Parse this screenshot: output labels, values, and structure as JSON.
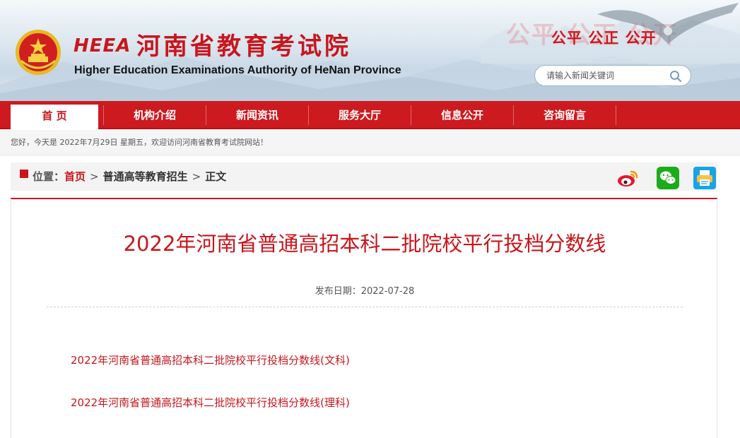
{
  "header": {
    "logo_abbr": "HEEA",
    "logo_name_cn": "河南省教育考试院",
    "logo_name_en": "Higher Education Examinations Authority of HeNan Province",
    "slogan": "公平 公正 公开",
    "slogan_ghost": "公平 公正 公开",
    "search": {
      "placeholder": "请输入新闻关键词",
      "value": ""
    }
  },
  "nav": {
    "items": [
      {
        "label": "首 页",
        "active": true
      },
      {
        "label": "机构介绍"
      },
      {
        "label": "新闻资讯"
      },
      {
        "label": "服务大厅"
      },
      {
        "label": "信息公开"
      },
      {
        "label": "咨询留言"
      }
    ]
  },
  "welcome": {
    "text": "您好，今天是 2022年7月29日 星期五，欢迎访问河南省教育考试院网站！"
  },
  "breadcrumb": {
    "prefix": "位置：",
    "home": "首页",
    "sep": ">",
    "section": "普通高等教育招生",
    "current": "正文"
  },
  "share": {
    "icons": [
      "weibo-icon",
      "wechat-icon",
      "print-icon"
    ]
  },
  "article": {
    "title": "2022年河南省普通高招本科二批院校平行投档分数线",
    "date_label": "发布日期：",
    "date": "2022-07-28",
    "links": [
      "2022年河南省普通高招本科二批院校平行投档分数线(文科)",
      "2022年河南省普通高招本科二批院校平行投档分数线(理科)"
    ]
  },
  "colors": {
    "brand_red": "#c8161d",
    "nav_red": "#cc1a1f"
  }
}
